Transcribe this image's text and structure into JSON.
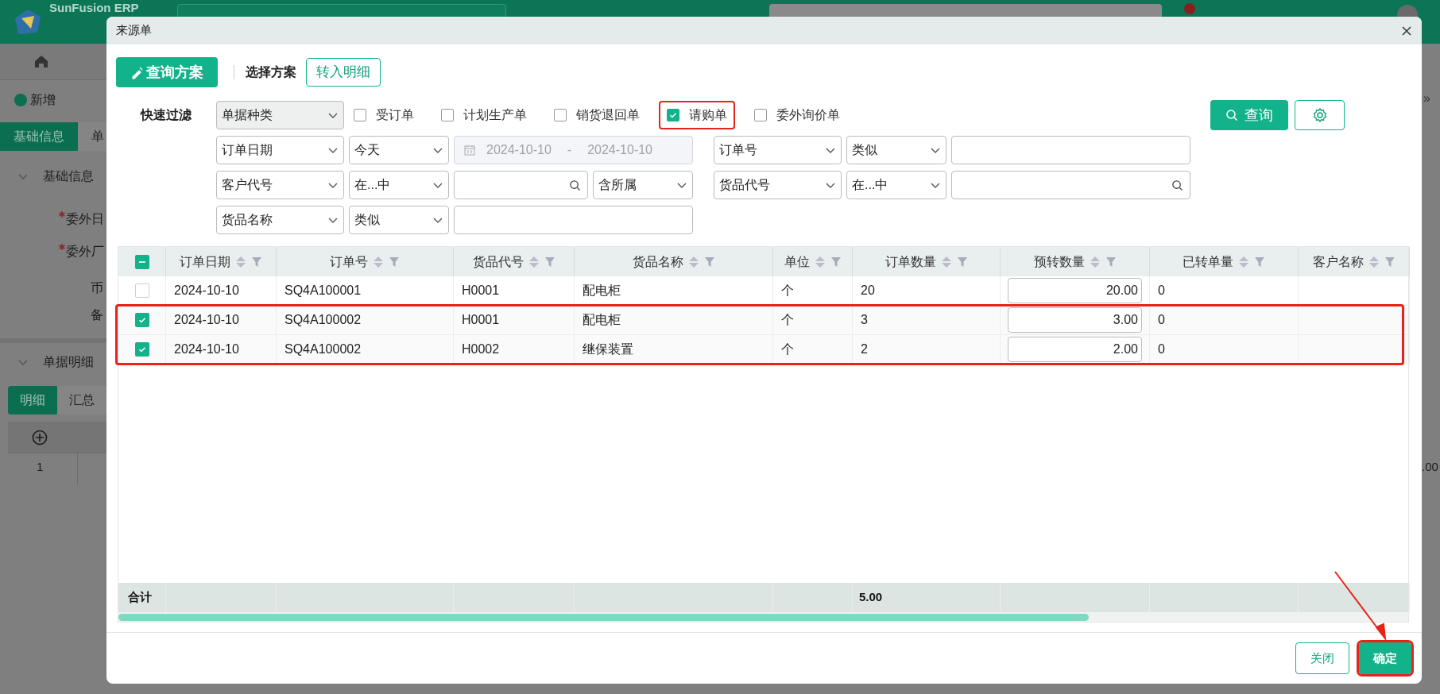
{
  "background": {
    "brand": "SunFusion ERP",
    "new_button": "新增",
    "tabs": [
      {
        "label": "基础信息",
        "selected": true
      },
      {
        "label": "单",
        "selected": false
      }
    ],
    "section_title": "基础信息",
    "fields": [
      {
        "label": "委外日",
        "required": true
      },
      {
        "label": "委外厂",
        "required": true
      },
      {
        "label": "币",
        "required": false
      },
      {
        "label": "备",
        "required": false
      }
    ],
    "detail_section": "单据明细",
    "detail_tabs": [
      {
        "label": "明细",
        "selected": true
      },
      {
        "label": "汇总",
        "selected": false
      }
    ],
    "row_number": "1",
    "collapse_glyph": "»",
    "right_cell": ".00"
  },
  "dialog": {
    "title": "来源单",
    "scheme_button": "查询方案",
    "scheme_label": "选择方案",
    "transfer_button": "转入明细",
    "quick_filter": {
      "label": "快速过滤",
      "doc_type": "单据种类",
      "types": [
        {
          "label": "受订单",
          "checked": false,
          "highlighted": false
        },
        {
          "label": "计划生产单",
          "checked": false,
          "highlighted": false
        },
        {
          "label": "销货退回单",
          "checked": false,
          "highlighted": false
        },
        {
          "label": "请购单",
          "checked": true,
          "highlighted": true
        },
        {
          "label": "委外询价单",
          "checked": false,
          "highlighted": false
        }
      ]
    },
    "query_button": "查询",
    "filters": [
      {
        "left": [
          {
            "kind": "select",
            "value": "订单日期"
          },
          {
            "kind": "select",
            "value": "今天"
          },
          {
            "kind": "daterange",
            "from": "2024-10-10",
            "separator": "-",
            "to": "2024-10-10"
          }
        ],
        "right": [
          {
            "kind": "select",
            "value": "订单号"
          },
          {
            "kind": "select",
            "value": "类似"
          },
          {
            "kind": "input"
          }
        ]
      },
      {
        "left": [
          {
            "kind": "select",
            "value": "客户代号"
          },
          {
            "kind": "select",
            "value": "在...中"
          },
          {
            "kind": "search"
          },
          {
            "kind": "select",
            "value": "含所属"
          }
        ],
        "right": [
          {
            "kind": "select",
            "value": "货品代号"
          },
          {
            "kind": "select",
            "value": "在...中"
          },
          {
            "kind": "search"
          }
        ]
      },
      {
        "left": [
          {
            "kind": "select",
            "value": "货品名称"
          },
          {
            "kind": "select",
            "value": "类似"
          },
          {
            "kind": "input"
          }
        ]
      }
    ],
    "table": {
      "select_all_indeterminate": true,
      "columns": [
        {
          "label": "订单日期",
          "kind": "text"
        },
        {
          "label": "订单号",
          "kind": "text"
        },
        {
          "label": "货品代号",
          "kind": "text"
        },
        {
          "label": "货品名称",
          "kind": "text"
        },
        {
          "label": "单位",
          "kind": "text"
        },
        {
          "label": "订单数量",
          "kind": "text",
          "total": "5.00"
        },
        {
          "label": "预转数量",
          "kind": "input"
        },
        {
          "label": "已转单量",
          "kind": "text"
        },
        {
          "label": "客户名称",
          "kind": "text"
        }
      ],
      "rows": [
        {
          "selected": false,
          "highlighted": false,
          "cells": [
            "2024-10-10",
            "SQ4A100001",
            "H0001",
            "配电柜",
            "个",
            "20",
            "20.00",
            "0"
          ]
        },
        {
          "selected": true,
          "highlighted": true,
          "cells": [
            "2024-10-10",
            "SQ4A100002",
            "H0001",
            "配电柜",
            "个",
            "3",
            "3.00",
            "0"
          ]
        },
        {
          "selected": true,
          "highlighted": true,
          "cells": [
            "2024-10-10",
            "SQ4A100002",
            "H0002",
            "继保装置",
            "个",
            "2",
            "2.00",
            "0"
          ]
        }
      ],
      "totals_label": "合计"
    },
    "buttons": [
      {
        "label": "关闭",
        "kind": "secondary",
        "highlighted": false
      },
      {
        "label": "确定",
        "kind": "primary",
        "highlighted": true
      }
    ]
  }
}
